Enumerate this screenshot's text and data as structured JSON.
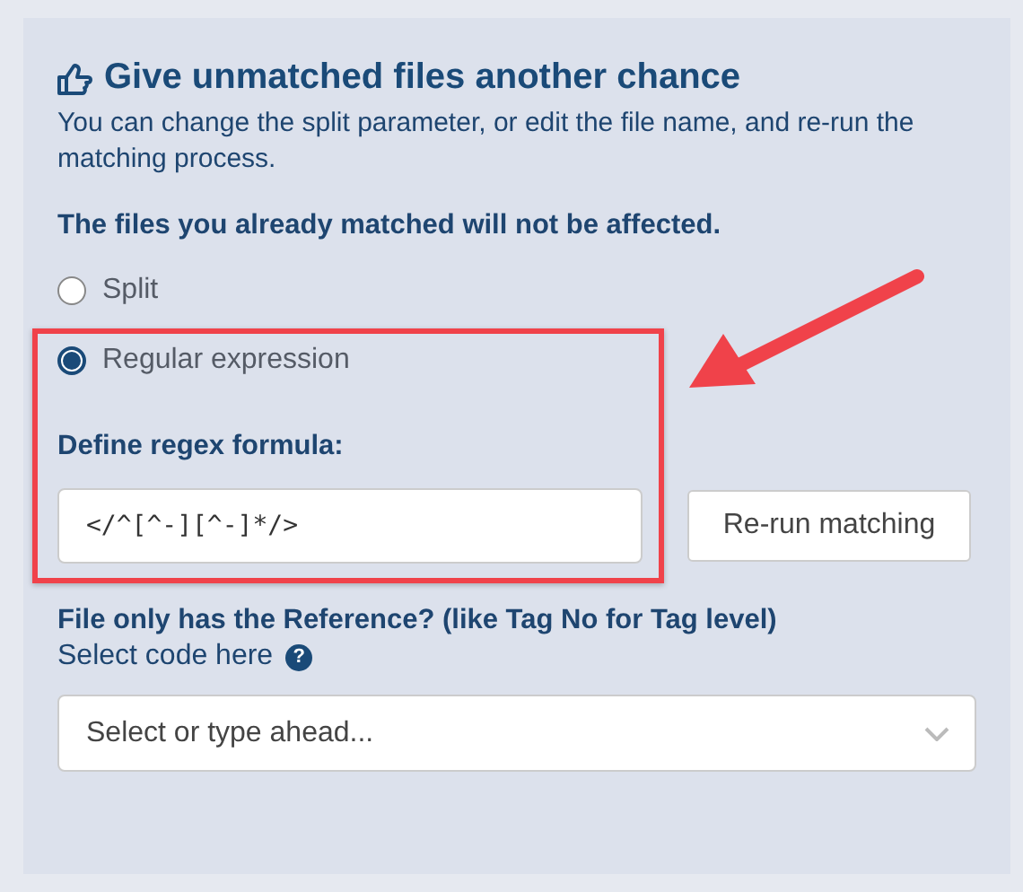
{
  "panel": {
    "title": "Give unmatched files another chance",
    "description": "You can change the split parameter, or edit the file name, and re-run the matching process.",
    "note": "The files you already matched will not be affected.",
    "modes": [
      {
        "label": "Split",
        "selected": false
      },
      {
        "label": "Regular expression",
        "selected": true
      }
    ],
    "regex": {
      "label": "Define regex formula:",
      "value": "</^[^-][^-]*/>"
    },
    "rerun_button": "Re-run matching",
    "reference": {
      "label": "File only has the Reference? (like Tag No for Tag level)",
      "hint": "Select code here",
      "help_icon": "?",
      "select_placeholder": "Select or type ahead..."
    }
  }
}
